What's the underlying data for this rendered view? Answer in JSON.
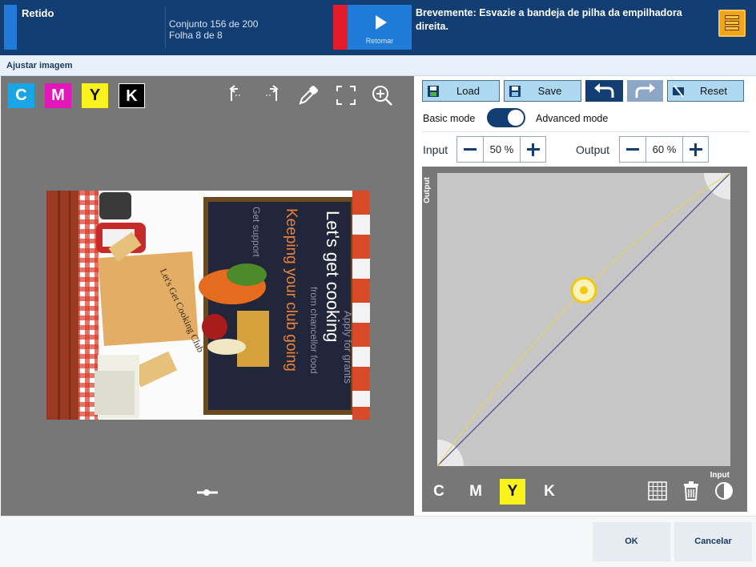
{
  "status": {
    "title": "Retido",
    "job_set": "Conjunto 156 de 200",
    "job_sheet": "Folha 8 de 8",
    "resume_label": "Retomar",
    "message": "Brevemente: Esvazie a bandeja de pilha da empilhadora direita."
  },
  "page": {
    "title": "Ajustar imagem"
  },
  "preview": {
    "separations": [
      "C",
      "M",
      "Y",
      "K"
    ],
    "toolbar_icons": [
      "rotate-left-icon",
      "rotate-right-icon",
      "eyedropper-icon",
      "fit-screen-icon",
      "zoom-in-icon"
    ],
    "document": {
      "chalkboard_title": "Let's get cooking",
      "chalkboard_tagline": "Keeping your club going",
      "chalkboard_faint_1": "Apply for grants",
      "chalkboard_faint_2": "Get support",
      "chalkboard_faint_3": "from chancellor food",
      "note_text": "Let's Get Cooking Club"
    }
  },
  "toolbar": {
    "load_label": "Load",
    "save_label": "Save",
    "reset_label": "Reset"
  },
  "mode": {
    "basic_label": "Basic mode",
    "advanced_label": "Advanced mode",
    "advanced_enabled": true
  },
  "input": {
    "label": "Input",
    "value": "50 %"
  },
  "output": {
    "label": "Output",
    "value": "60 %"
  },
  "curve": {
    "y_axis_label": "Output",
    "x_axis_label": "Input",
    "active_channel": "Y",
    "channels": [
      "C",
      "M",
      "Y",
      "K"
    ],
    "control_point": {
      "input": 50,
      "output": 60
    },
    "colors": {
      "curve": "#e9d94a",
      "reference": "#4a4a9a",
      "point": "#f2c80f"
    }
  },
  "footer": {
    "ok_label": "OK",
    "cancel_label": "Cancelar"
  },
  "colors": {
    "topbar": "#123e74",
    "accent_blue": "#1f7ad8",
    "alert_red": "#e31b2a",
    "cyan": "#1aa6e6",
    "magenta": "#e317b8",
    "yellow": "#f9f21c",
    "black": "#000000"
  }
}
